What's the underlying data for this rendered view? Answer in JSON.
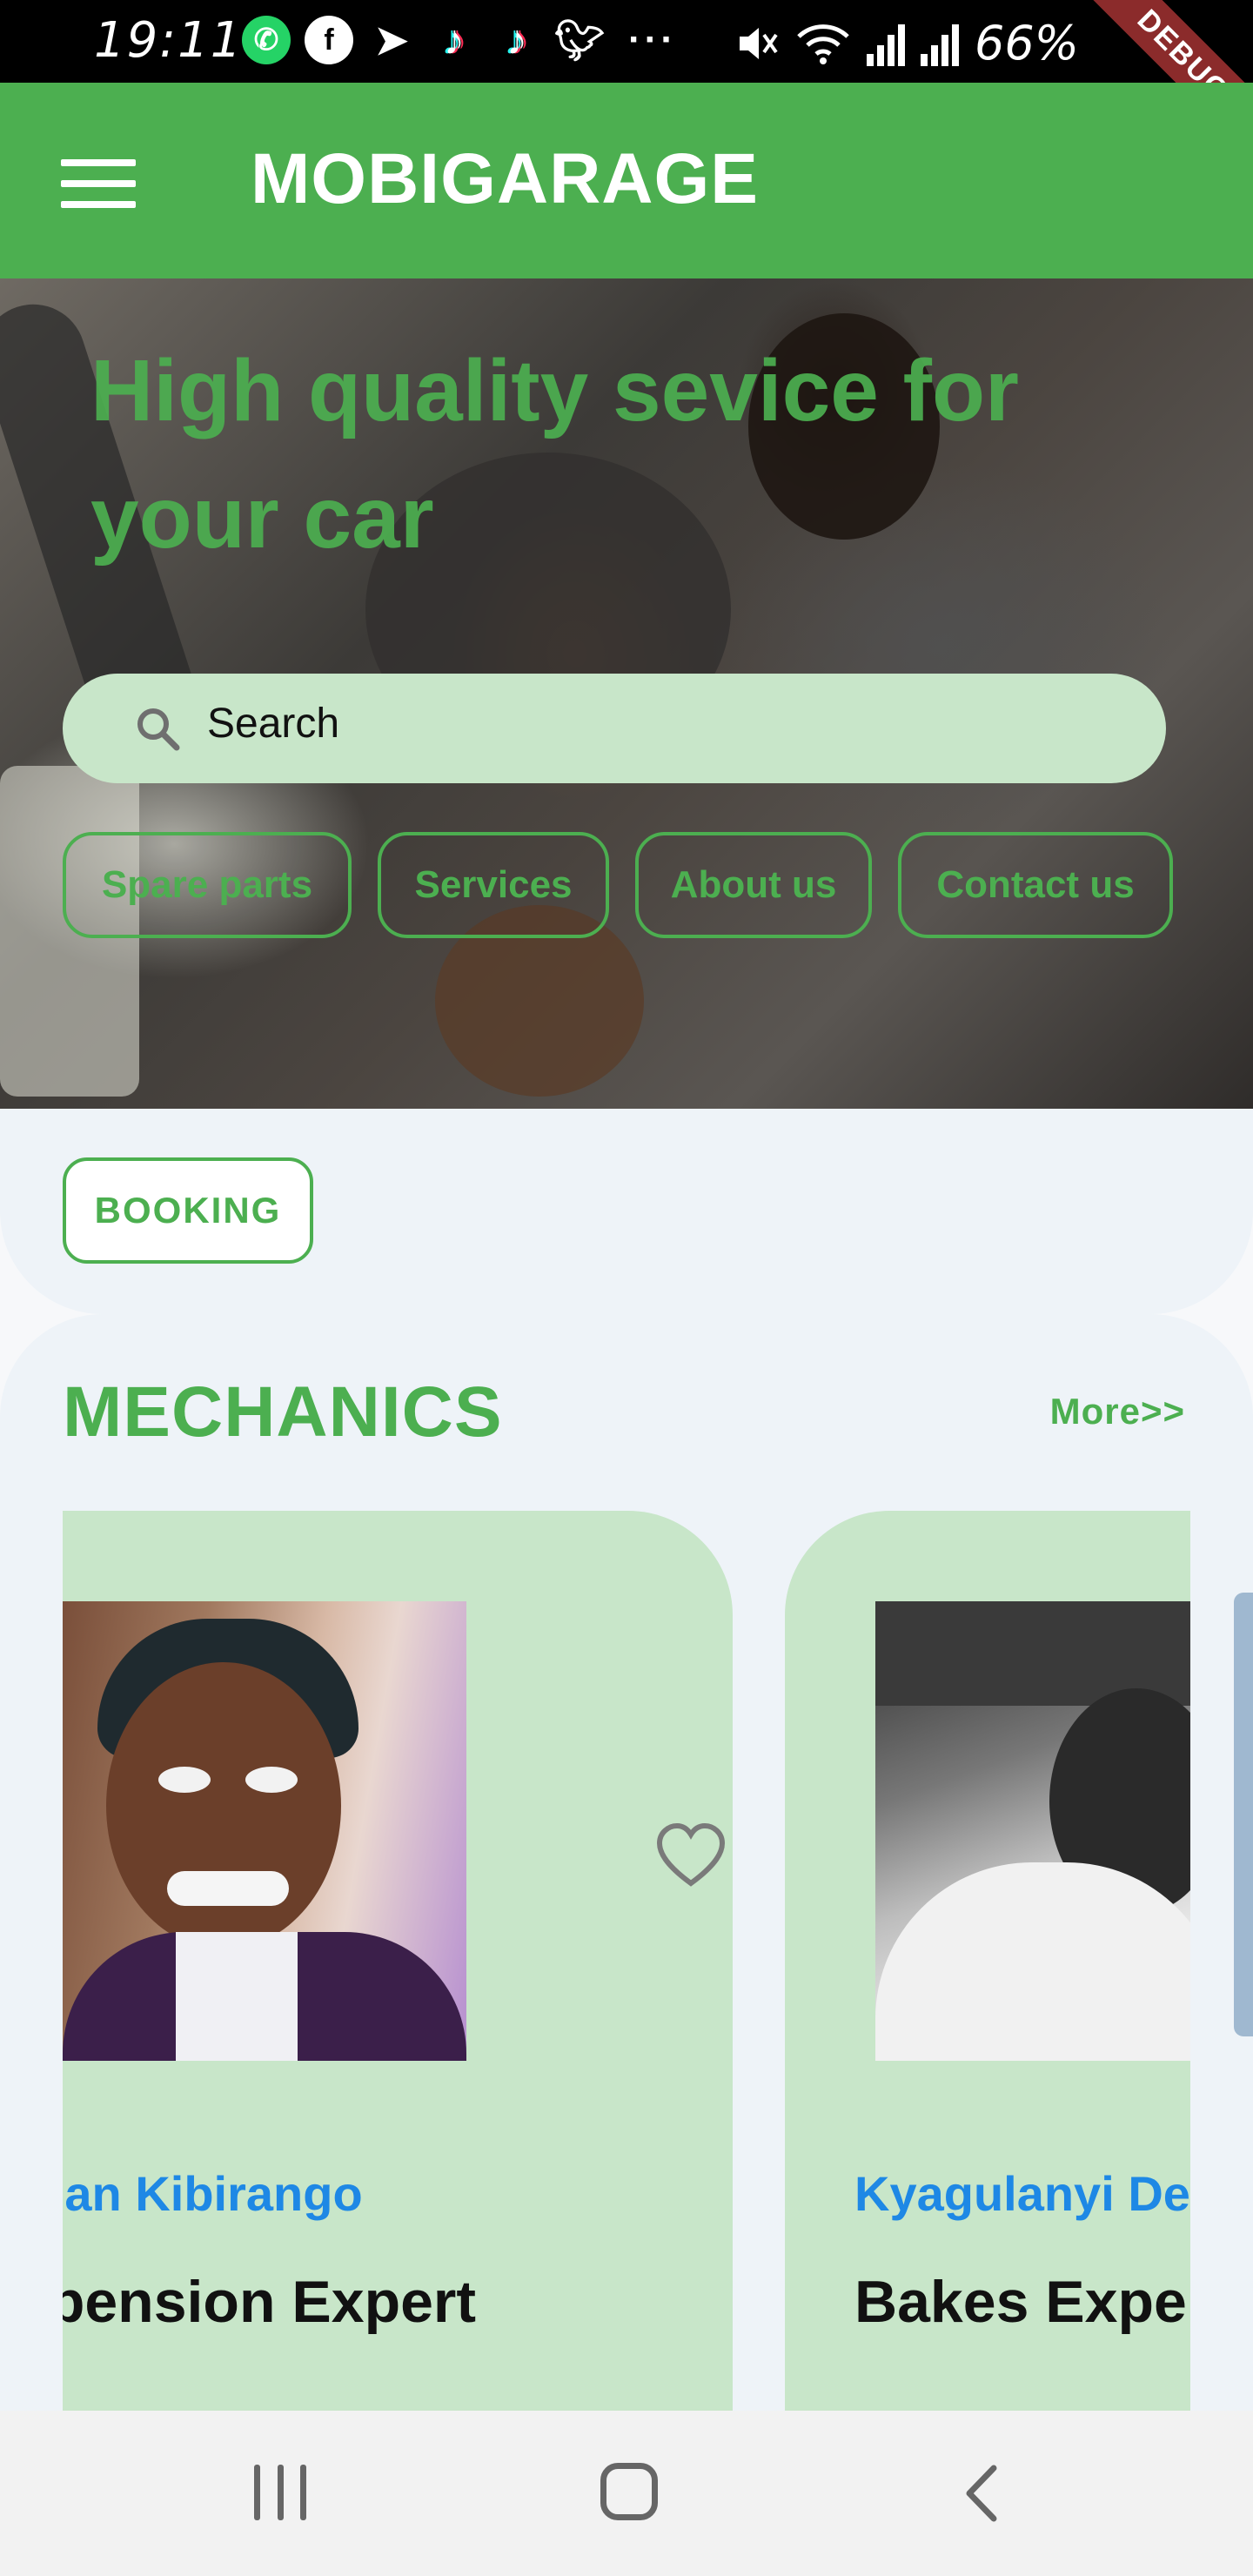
{
  "status_bar": {
    "time": "19:11",
    "app_icons": [
      "whatsapp-icon",
      "facebook-icon",
      "telegram-icon",
      "tiktok-icon",
      "tiktok-icon",
      "twitter-icon"
    ],
    "overflow": "···",
    "battery": "66%",
    "debug_label": "DEBUG"
  },
  "app_bar": {
    "title": "MOBIGARAGE"
  },
  "hero": {
    "headline": "High quality sevice for your car",
    "search_placeholder": "Search",
    "chips": [
      "Spare parts",
      "Services",
      "About us",
      "Contact us"
    ]
  },
  "booking": {
    "label": "BOOKING"
  },
  "mechanics": {
    "title": "MECHANICS",
    "more_label": "More>>",
    "items": [
      {
        "name": "nnan Kibirango",
        "role": "spension Expert",
        "favorite": false
      },
      {
        "name": "Kyagulanyi De",
        "role": "Bakes Expe"
      }
    ]
  },
  "colors": {
    "primary": "#4caf50",
    "primary_light": "#c8e6c9",
    "name_blue": "#1e88e5",
    "section_bg": "#eef3f8"
  }
}
